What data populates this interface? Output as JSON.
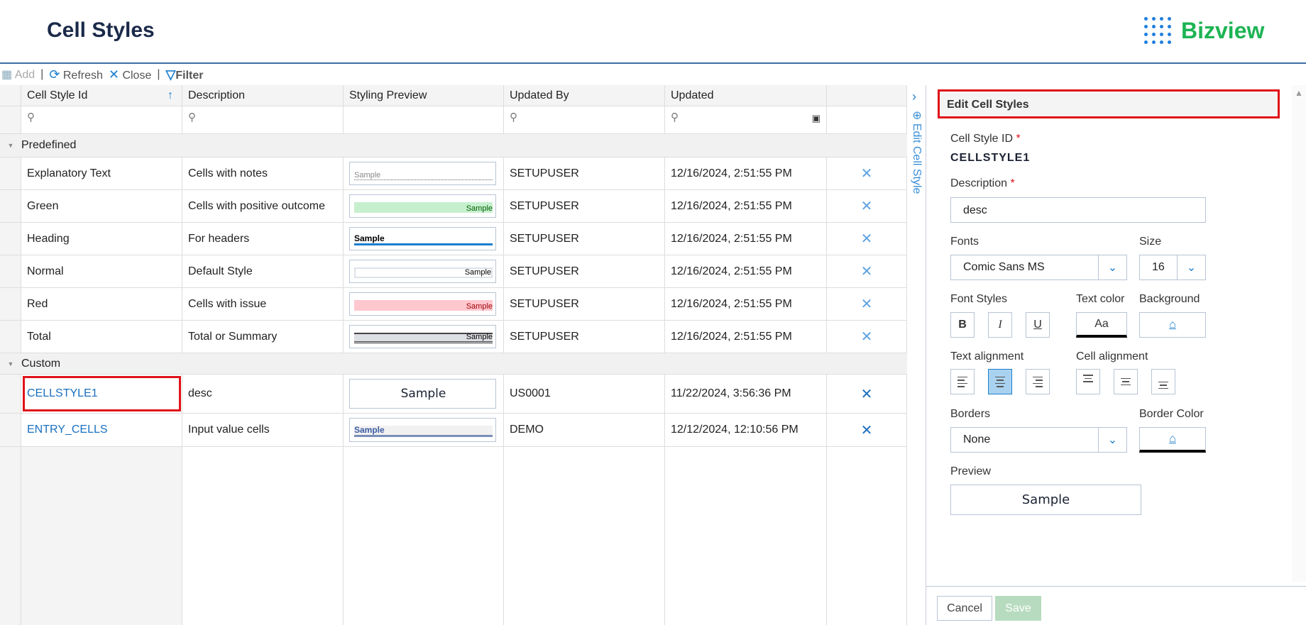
{
  "header": {
    "title": "Cell Styles",
    "logo": "Bizview"
  },
  "toolbar": {
    "add": "Add",
    "refresh": "Refresh",
    "close": "Close",
    "filter": "Filter"
  },
  "columns": [
    "Cell Style Id",
    "Description",
    "Styling Preview",
    "Updated By",
    "Updated"
  ],
  "groups": [
    {
      "label": "Predefined",
      "rows": [
        {
          "id": "Explanatory Text",
          "description": "Cells with notes",
          "preview": "Sample",
          "updated_by": "SETUPUSER",
          "updated": "12/16/2024, 2:51:55 PM"
        },
        {
          "id": "Green",
          "description": "Cells with positive outcome",
          "preview": "Sample",
          "updated_by": "SETUPUSER",
          "updated": "12/16/2024, 2:51:55 PM"
        },
        {
          "id": "Heading",
          "description": "For headers",
          "preview": "Sample",
          "updated_by": "SETUPUSER",
          "updated": "12/16/2024, 2:51:55 PM"
        },
        {
          "id": "Normal",
          "description": "Default Style",
          "preview": "Sample",
          "updated_by": "SETUPUSER",
          "updated": "12/16/2024, 2:51:55 PM"
        },
        {
          "id": "Red",
          "description": "Cells with issue",
          "preview": "Sample",
          "updated_by": "SETUPUSER",
          "updated": "12/16/2024, 2:51:55 PM"
        },
        {
          "id": "Total",
          "description": "Total or Summary",
          "preview": "Sample",
          "updated_by": "SETUPUSER",
          "updated": "12/16/2024, 2:51:55 PM"
        }
      ]
    },
    {
      "label": "Custom",
      "rows": [
        {
          "id": "CELLSTYLE1",
          "description": "desc",
          "preview": "Sample",
          "updated_by": "US0001",
          "updated": "11/22/2024, 3:56:36 PM"
        },
        {
          "id": "ENTRY_CELLS",
          "description": "Input value cells",
          "preview": "Sample",
          "updated_by": "DEMO",
          "updated": "12/12/2024, 12:10:56 PM"
        }
      ]
    }
  ],
  "side_tab": "Edit Cell Style",
  "panel": {
    "title": "Edit Cell Styles",
    "id_label": "Cell Style ID",
    "id_value": "CELLSTYLE1",
    "required": "*",
    "desc_label": "Description",
    "desc_value": "desc",
    "fonts_label": "Fonts",
    "font_value": "Comic Sans MS",
    "size_label": "Size",
    "size_value": "16",
    "font_styles_label": "Font Styles",
    "bold": "B",
    "italic": "I",
    "underline": "U",
    "text_color_label": "Text color",
    "text_color_sample": "Aa",
    "background_label": "Background",
    "text_align_label": "Text alignment",
    "cell_align_label": "Cell alignment",
    "borders_label": "Borders",
    "borders_value": "None",
    "border_color_label": "Border Color",
    "preview_label": "Preview",
    "preview_text": "Sample",
    "cancel": "Cancel",
    "save": "Save"
  },
  "colors": {
    "accent": "#1a7fd0",
    "highlight": "#e0121a",
    "save": "#b7dbbf",
    "brand": "#1db454"
  }
}
